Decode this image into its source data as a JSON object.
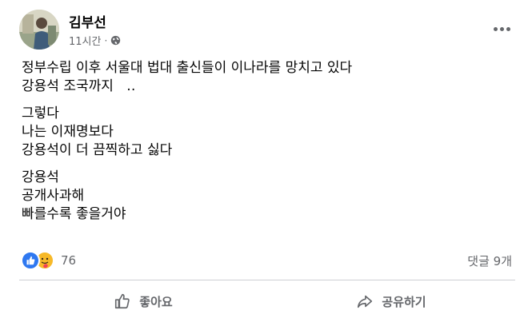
{
  "post": {
    "author": "김부선",
    "time": "11시간",
    "separator": "·",
    "paragraphs": [
      [
        "정부수립 이후 서울대 법대 출신들이 이나라를 망치고 있다",
        "강용석 조국까지   ‥"
      ],
      [
        "그렇다",
        "나는 이재명보다",
        "강용석이 더 끔찍하고 싫다"
      ],
      [
        "강용석",
        "공개사과해",
        "빠를수록 좋을거야"
      ]
    ]
  },
  "stats": {
    "reaction_count": "76",
    "comment_count": "댓글 9개"
  },
  "actions": {
    "like_label": "좋아요",
    "share_label": "공유하기"
  },
  "colors": {
    "like_blue": "#2f78f0",
    "care_yellow": "#f7b928",
    "secondary_text": "#65676b"
  }
}
